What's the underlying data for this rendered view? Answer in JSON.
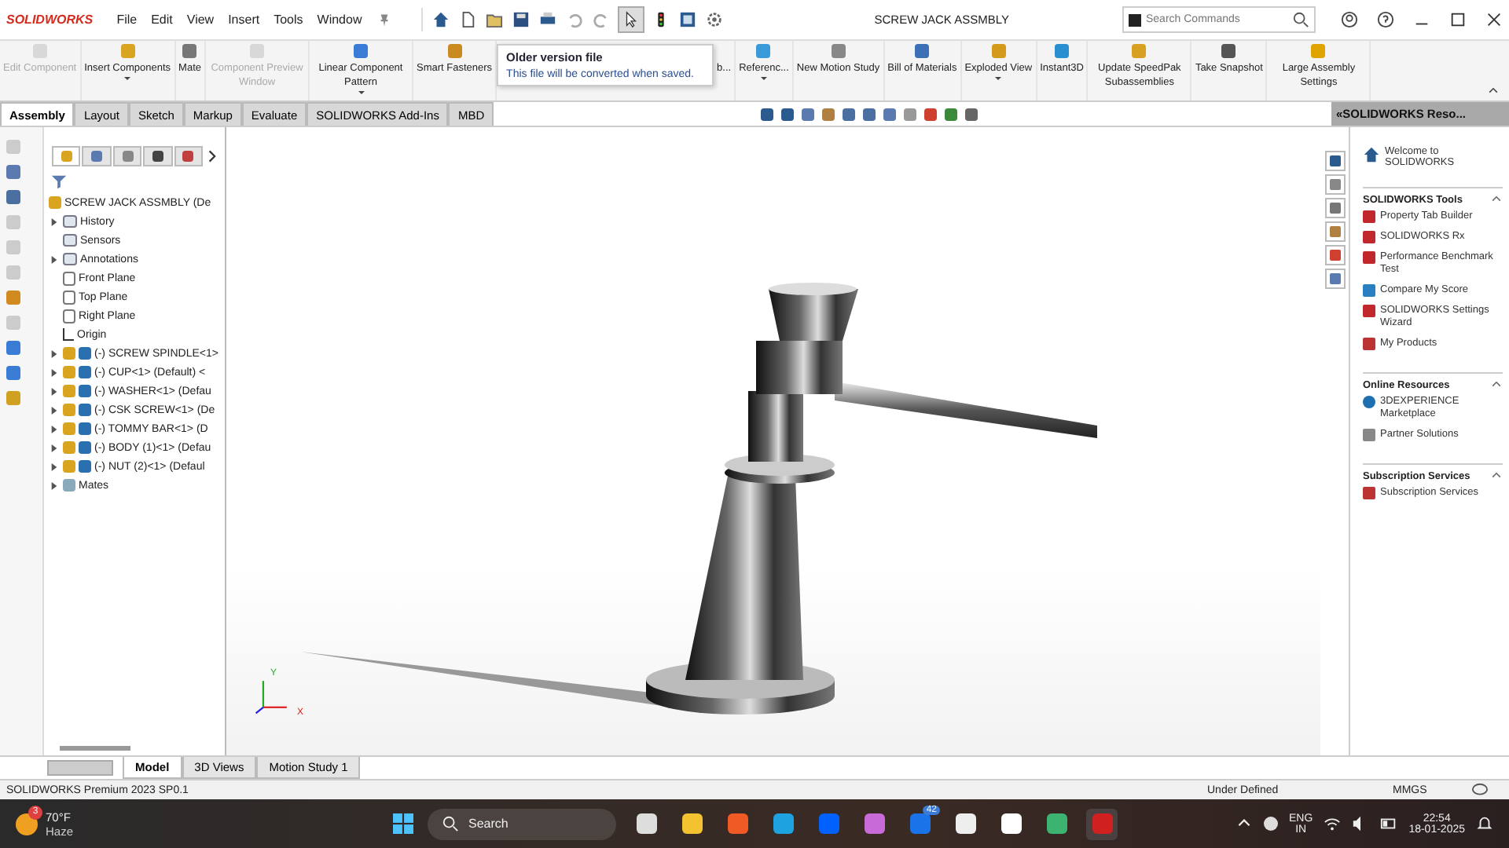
{
  "app": {
    "logo": "SOLIDWORKS",
    "title": "SCREW JACK ASSMBLY",
    "menu": [
      "File",
      "Edit",
      "View",
      "Insert",
      "Tools",
      "Window"
    ],
    "search": {
      "placeholder": "Search Commands"
    }
  },
  "tooltip": {
    "title": "Older version file",
    "text": "This file will be converted when saved."
  },
  "ribbon": [
    {
      "label": "Edit Component",
      "disabled": true,
      "dropdown": false
    },
    {
      "label": "Insert Components",
      "disabled": false,
      "dropdown": true
    },
    {
      "label": "Mate",
      "disabled": false,
      "dropdown": false
    },
    {
      "label": "Component Preview Window",
      "disabled": true,
      "dropdown": false
    },
    {
      "label": "Linear Component Pattern",
      "disabled": false,
      "dropdown": true
    },
    {
      "label": "Smart Fasteners",
      "disabled": false,
      "dropdown": false
    },
    {
      "label": "b...",
      "disabled": false,
      "dropdown": false
    },
    {
      "label": "Referenc...",
      "disabled": false,
      "dropdown": true
    },
    {
      "label": "New Motion Study",
      "disabled": false,
      "dropdown": false
    },
    {
      "label": "Bill of Materials",
      "disabled": false,
      "dropdown": false
    },
    {
      "label": "Exploded View",
      "disabled": false,
      "dropdown": true
    },
    {
      "label": "Instant3D",
      "disabled": false,
      "dropdown": false
    },
    {
      "label": "Update SpeedPak Subassemblies",
      "disabled": false,
      "dropdown": false
    },
    {
      "label": "Take Snapshot",
      "disabled": false,
      "dropdown": false
    },
    {
      "label": "Large Assembly Settings",
      "disabled": false,
      "dropdown": false
    }
  ],
  "panel_tabs": [
    {
      "selected": true
    },
    {
      "selected": false
    },
    {
      "selected": false
    },
    {
      "selected": false
    },
    {
      "selected": false
    }
  ],
  "tabs": [
    {
      "label": "Assembly",
      "selected": true
    },
    {
      "label": "Layout",
      "selected": false
    },
    {
      "label": "Sketch",
      "selected": false
    },
    {
      "label": "Markup",
      "selected": false
    },
    {
      "label": "Evaluate",
      "selected": false
    },
    {
      "label": "SOLIDWORKS Add-Ins",
      "selected": false
    },
    {
      "label": "MBD",
      "selected": false
    }
  ],
  "tree": {
    "label": "SCREW JACK ASSMBLY (De",
    "children": [
      {
        "label": "History",
        "kind": "folder",
        "expandable": true
      },
      {
        "label": "Sensors",
        "kind": "folder",
        "expandable": false
      },
      {
        "label": "Annotations",
        "kind": "annotation",
        "expandable": true
      },
      {
        "label": "Front Plane",
        "kind": "plane",
        "expandable": false
      },
      {
        "label": "Top Plane",
        "kind": "plane",
        "expandable": false
      },
      {
        "label": "Right Plane",
        "kind": "plane",
        "expandable": false
      },
      {
        "label": "Origin",
        "kind": "origin",
        "expandable": false
      },
      {
        "label": "(-) SCREW SPINDLE<1>",
        "kind": "part",
        "expandable": true
      },
      {
        "label": "(-) CUP<1> (Default) <",
        "kind": "part",
        "expandable": true
      },
      {
        "label": "(-) WASHER<1> (Defau",
        "kind": "part",
        "expandable": true
      },
      {
        "label": "(-) CSK SCREW<1> (De",
        "kind": "part",
        "expandable": true
      },
      {
        "label": "(-) TOMMY BAR<1> (D",
        "kind": "part",
        "expandable": true
      },
      {
        "label": "(-) BODY (1)<1> (Defau",
        "kind": "part",
        "expandable": true
      },
      {
        "label": "(-) NUT (2)<1> (Defaul",
        "kind": "part",
        "expandable": true
      },
      {
        "label": "Mates",
        "kind": "mates",
        "expandable": true
      }
    ]
  },
  "triad": [
    "Y",
    "X"
  ],
  "task_pane": {
    "title": "«SOLIDWORKS Reso...",
    "welcome": "Welcome to SOLIDWORKS",
    "sections": [
      {
        "title": "SOLIDWORKS Tools",
        "expanded": true,
        "items": [
          {
            "label": "Property Tab Builder",
            "kind": "tool"
          },
          {
            "label": "SOLIDWORKS Rx",
            "kind": "tool"
          },
          {
            "label": "Performance Benchmark Test",
            "kind": "tool"
          },
          {
            "label": "Compare My Score",
            "kind": "score"
          },
          {
            "label": "SOLIDWORKS Settings Wizard",
            "kind": "wizard"
          },
          {
            "label": "My Products",
            "kind": "products"
          }
        ]
      },
      {
        "title": "Online Resources",
        "expanded": true,
        "items": [
          {
            "label": "3DEXPERIENCE Marketplace",
            "kind": "globe"
          },
          {
            "label": "Partner Solutions",
            "kind": "handshake"
          }
        ]
      },
      {
        "title": "Subscription Services",
        "expanded": true,
        "items": [
          {
            "label": "Subscription Services",
            "kind": "subscription"
          }
        ]
      }
    ]
  },
  "bottom_tabs": [
    {
      "label": "Model",
      "selected": true
    },
    {
      "label": "3D Views",
      "selected": false
    },
    {
      "label": "Motion Study 1",
      "selected": false
    }
  ],
  "status_bar": {
    "product": "SOLIDWORKS Premium 2023 SP0.1",
    "state": "Under Defined",
    "units": "MMGS"
  },
  "taskbar": {
    "weather": {
      "temp": "70°F",
      "condition": "Haze",
      "badge": "3"
    },
    "search": "Search",
    "apps": [
      {
        "kind": "taskview"
      },
      {
        "kind": "explorer"
      },
      {
        "kind": "brave"
      },
      {
        "kind": "edge"
      },
      {
        "kind": "dropbox"
      },
      {
        "kind": "copilot"
      },
      {
        "kind": "mail",
        "badge": "42"
      },
      {
        "kind": "store"
      },
      {
        "kind": "amazon"
      },
      {
        "kind": "maps"
      },
      {
        "kind": "solidworks"
      }
    ],
    "lang": "ENG",
    "region": "IN",
    "time": "22:54",
    "date": "18-01-2025"
  }
}
